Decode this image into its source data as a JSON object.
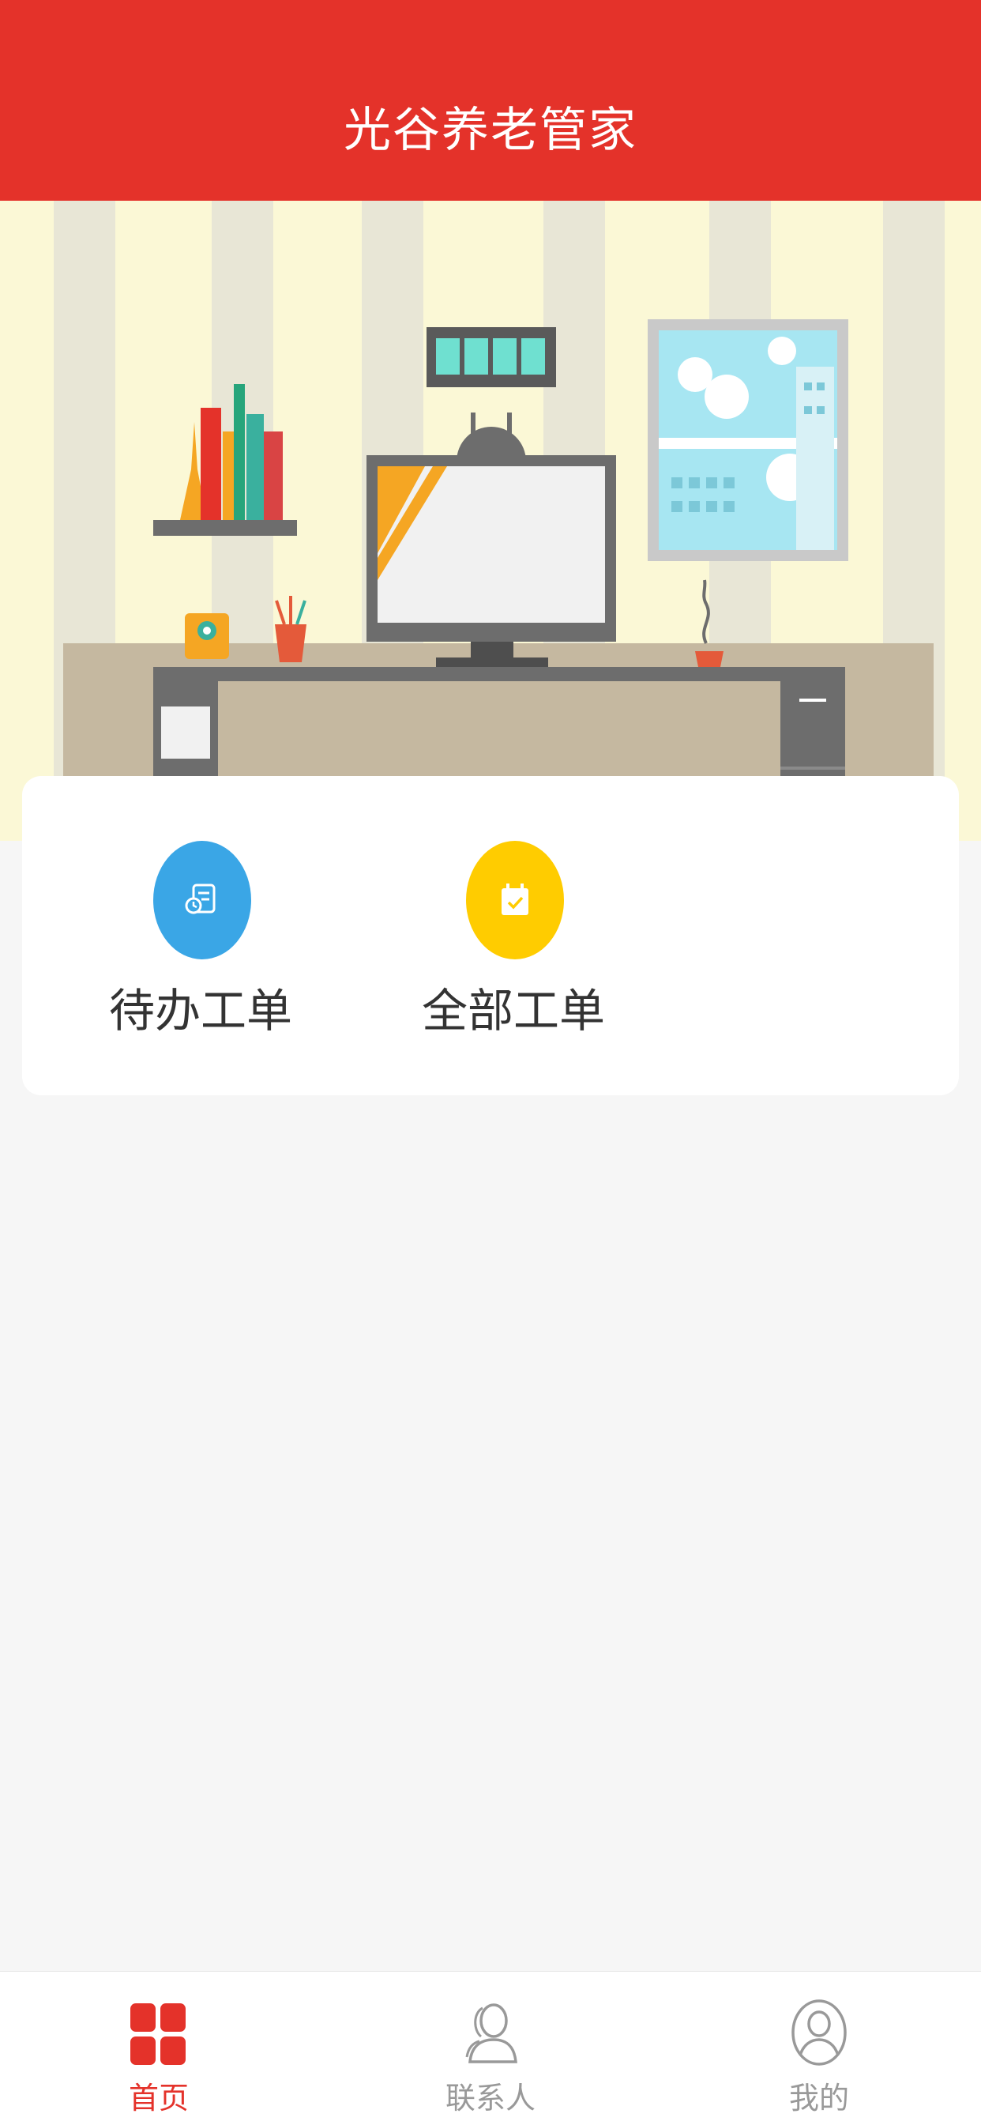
{
  "header": {
    "title": "光谷养老管家",
    "color": "#e4322a"
  },
  "shortcuts": [
    {
      "label": "待办工单",
      "icon": "pending-order-icon",
      "color": "#3aa6e6"
    },
    {
      "label": "全部工单",
      "icon": "calendar-check-icon",
      "color": "#ffcc00"
    }
  ],
  "tabbar": {
    "items": [
      {
        "label": "首页",
        "icon": "grid-icon",
        "active": true,
        "color": "#e4322a"
      },
      {
        "label": "联系人",
        "icon": "contact-icon",
        "active": false,
        "color": "#999999"
      },
      {
        "label": "我的",
        "icon": "user-icon",
        "active": false,
        "color": "#999999"
      }
    ]
  }
}
